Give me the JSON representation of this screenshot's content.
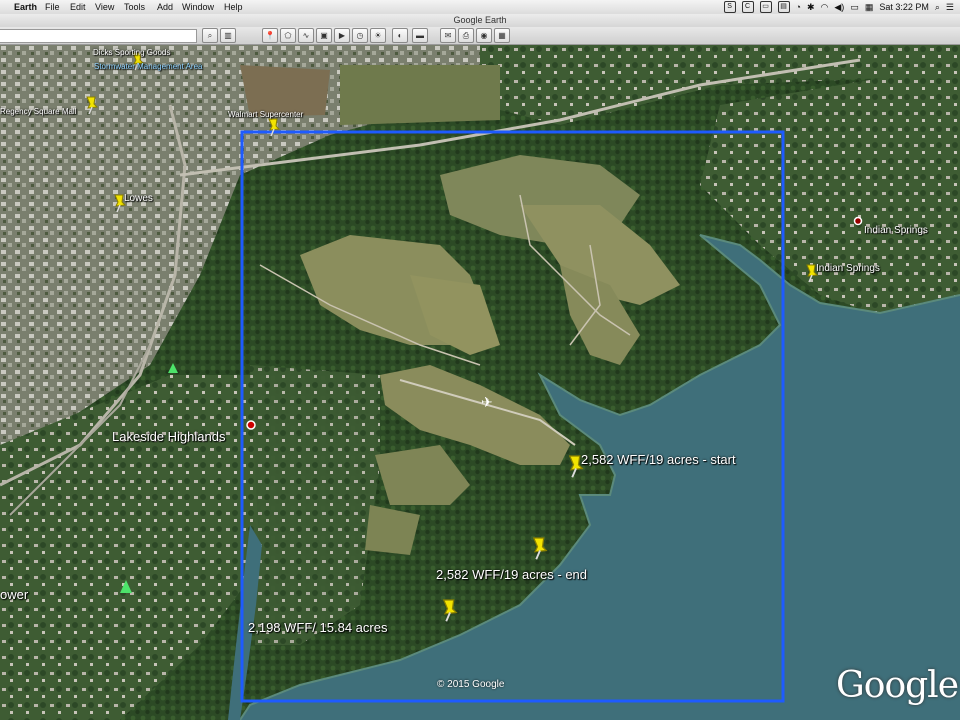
{
  "menubar": {
    "menus": [
      "Earth",
      "File",
      "Edit",
      "View",
      "Tools",
      "Add",
      "Window",
      "Help"
    ],
    "clock": "Sat 3:22 PM"
  },
  "window": {
    "title": "Google Earth"
  },
  "map": {
    "labels": {
      "dicks": "Dicks Sporting Goods",
      "stormwater": "Stormwater Management Area",
      "regency": "Regency Square Mall",
      "walmart": "Walmart Supercenter",
      "lowes": "Lowes",
      "indian1": "Indian Springs",
      "indian2": "Indian Springs",
      "lakeside": "Lakeside Highlands",
      "tower": "ower",
      "start": "2,582 WFF/19 acres - start",
      "end": "2,582 WFF/19 acres - end",
      "other": "2,198 WFF/ 15.84  acres"
    },
    "copyright": "© 2015 Google",
    "logo": "Google",
    "colors": {
      "selection_box": "#1e5bff",
      "water": "#3f6f7a",
      "pin": "#f2e300"
    }
  }
}
